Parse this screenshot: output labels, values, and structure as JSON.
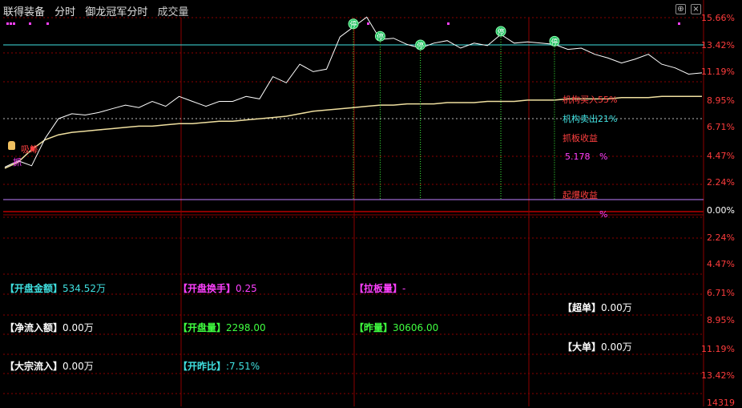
{
  "header": {
    "stock_name": "联得装备",
    "mode": "分时",
    "indicator": "御龙冠军分时",
    "volume_label": "成交量",
    "btn_plus": "⊕",
    "btn_close": "×"
  },
  "price_axis": [
    "15.66%",
    "13.42%",
    "11.19%",
    "8.95%",
    "6.71%",
    "4.47%",
    "2.24%",
    "0.00%"
  ],
  "lower_axis": [
    "2.24%",
    "4.47%",
    "6.71%",
    "8.95%",
    "11.19%",
    "13.42%",
    "14319"
  ],
  "annotations": {
    "inst_buy": "机构买入55%",
    "inst_sell": "机构卖出21%",
    "catch_limit_profit": "抓板收益",
    "catch_value": "5.178",
    "percent1": "%",
    "break_profit": "起爆收益",
    "percent2": "%",
    "absorb": "吸筹",
    "catch": "抓",
    "limit_marker": "停"
  },
  "stats": {
    "open_amount_label": "【开盘金额】",
    "open_amount_value": "534.52万",
    "open_turnover_label": "【开盘换手】",
    "open_turnover_value": "0.25",
    "pull_volume_label": "【拉板量】",
    "pull_volume_value": "-",
    "super_order_label": "【超单】",
    "super_order_value": "0.00万",
    "net_inflow_label": "【净流入额】",
    "net_inflow_value": "0.00万",
    "open_volume_label": "【开盘量】",
    "open_volume_value": "2298.00",
    "prev_volume_label": "【昨量】",
    "prev_volume_value": "30606.00",
    "large_order_label": "【大单】",
    "large_order_value": "0.00万",
    "block_inflow_label": "【大宗流入】",
    "block_inflow_value": "0.00万",
    "open_ratio_label": "【开昨比】",
    "open_ratio_value": ":7.51%"
  },
  "colors": {
    "grid_red": "#8b0000",
    "axis_red": "#ff3c3c",
    "price_line": "#ffffff",
    "avg_line": "#f0e0a0",
    "cyan": "#40e0e0",
    "magenta": "#ff40ff",
    "green": "#40ff40",
    "red_text": "#ff4040"
  },
  "chart_data": {
    "type": "line",
    "series": [
      {
        "values": [
          3.6,
          4.1,
          3.7,
          5.9,
          7.5,
          7.9,
          7.8,
          8.0,
          8.3,
          8.6,
          8.4,
          8.9,
          8.5,
          9.3,
          8.9,
          8.5,
          8.9,
          8.9,
          9.3,
          9.1,
          10.9,
          10.4,
          11.9,
          11.3,
          11.5,
          14.1,
          14.9,
          15.7,
          13.9,
          14.0,
          13.5,
          13.2,
          13.6,
          13.8,
          13.2,
          13.6,
          13.4,
          14.3,
          13.6,
          13.7,
          13.6,
          13.5,
          13.1,
          13.2,
          12.7,
          12.4,
          12.0,
          12.3,
          12.7,
          11.9,
          11.6,
          11.1,
          11.2
        ]
      },
      {
        "values": [
          3.5,
          4.0,
          5.0,
          5.8,
          6.2,
          6.4,
          6.5,
          6.6,
          6.7,
          6.8,
          6.9,
          6.9,
          7.0,
          7.1,
          7.1,
          7.2,
          7.3,
          7.3,
          7.4,
          7.5,
          7.6,
          7.7,
          7.9,
          8.1,
          8.2,
          8.3,
          8.4,
          8.5,
          8.6,
          8.6,
          8.7,
          8.7,
          8.7,
          8.8,
          8.8,
          8.8,
          8.9,
          8.9,
          8.9,
          9.0,
          9.0,
          9.0,
          9.1,
          9.1,
          9.1,
          9.1,
          9.2,
          9.2,
          9.2,
          9.3,
          9.3,
          9.3,
          9.3
        ]
      }
    ],
    "limit_markers_at": [
      26,
      28,
      31,
      37,
      41
    ],
    "ylim": [
      0,
      15.66
    ],
    "grid": true
  }
}
